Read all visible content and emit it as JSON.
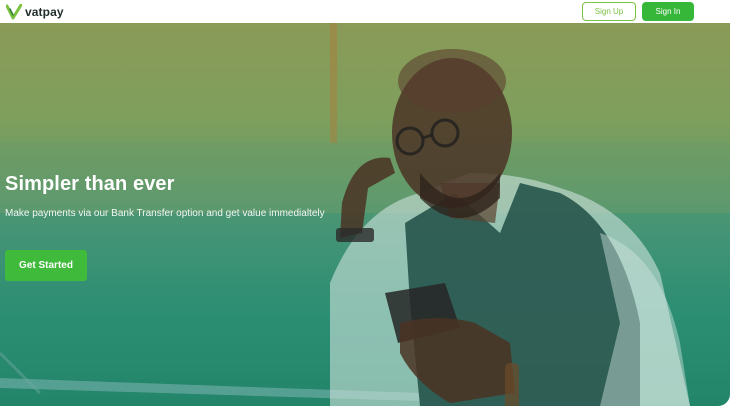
{
  "header": {
    "brand_name": "vatpay",
    "logo_icon": "v-check-logo-icon",
    "sign_up_label": "Sign Up",
    "sign_in_label": "Sign In"
  },
  "hero": {
    "title": "Simpler than ever",
    "subtitle": "Make payments via our Bank Transfer option and get value immedialtely",
    "cta_label": "Get Started",
    "image": "man-with-phone-hero-image"
  },
  "colors": {
    "brand_green": "#36b73a",
    "outline_green": "#7cc242",
    "overlay_top": "#8a9a57",
    "overlay_bottom": "#1e8266"
  }
}
